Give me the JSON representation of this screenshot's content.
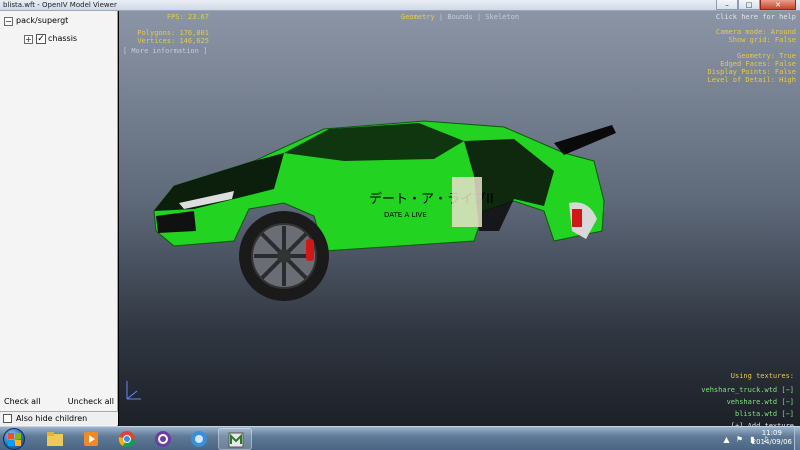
{
  "window": {
    "title": "blista.wft - OpenIV Model Viewer",
    "minimize": "–",
    "maximize": "□",
    "close": "✕"
  },
  "tree": {
    "root": {
      "label": "pack/supergt",
      "expander": "−"
    },
    "child": {
      "label": "chassis",
      "expander": "+",
      "checked": "✓"
    }
  },
  "panel": {
    "check_all": "Check all",
    "uncheck_all": "Uncheck all",
    "also_hide_children": "Also hide children"
  },
  "viewport": {
    "fps": "FPS: 23.67",
    "polygons": "Polygons: 176,801",
    "vertices": "Vertices: 146,625",
    "more_information": "[ More information ]",
    "modes": {
      "geometry": "Geometry",
      "sep1": " | ",
      "bounds": "Bounds",
      "sep2": " | ",
      "skeleton": "Skeleton"
    },
    "help": "Click here for help",
    "camera_mode": "Camera mode: Around",
    "show_grid": "Show grid: False",
    "geometry": "Geometry: True",
    "edged_faces": "Edged Faces: False",
    "display_points": "Display Points: False",
    "level_of_detail": "Level of Detail: High",
    "textures": {
      "heading": "Using textures:",
      "items": [
        "vehshare_truck.wtd [−]",
        "vehshare.wtd [−]",
        "blista.wtd [−]"
      ],
      "add": "[+] Add texture"
    },
    "axis": {
      "y": "y",
      "x": "x"
    }
  },
  "taskbar": {
    "time": "11:09",
    "date": "2014/09/06"
  },
  "colors": {
    "hud_yellow": "#e7c94a",
    "texture_green": "#7fe07f",
    "car_green": "#22d322"
  },
  "icons": [
    "windows-start-icon",
    "explorer-icon",
    "media-player-icon",
    "chrome-icon",
    "bittorrent-icon",
    "itunes-icon",
    "openiv-icon"
  ]
}
